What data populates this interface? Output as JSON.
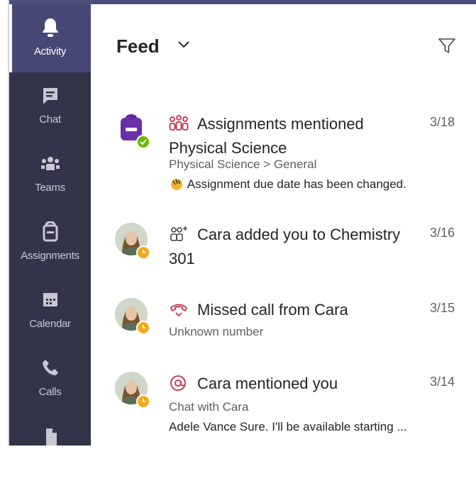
{
  "rail": {
    "items": [
      {
        "label": "Activity",
        "icon": "bell-icon",
        "active": true
      },
      {
        "label": "Chat",
        "icon": "chat-icon",
        "active": false
      },
      {
        "label": "Teams",
        "icon": "teams-icon",
        "active": false
      },
      {
        "label": "Assignments",
        "icon": "assignments-icon",
        "active": false
      },
      {
        "label": "Calendar",
        "icon": "calendar-icon",
        "active": false
      },
      {
        "label": "Calls",
        "icon": "phone-icon",
        "active": false
      },
      {
        "label": "",
        "icon": "files-icon",
        "active": false
      }
    ]
  },
  "header": {
    "title": "Feed"
  },
  "feed": [
    {
      "type_icon": "assignments-mention-icon",
      "title": "Assignments mentioned Physical Science",
      "date": "3/18",
      "line1": "Physical Science > General",
      "line2": "Assignment due date has been changed.",
      "avatar": "assignment-app-avatar",
      "status": "check"
    },
    {
      "type_icon": "added-to-team-icon",
      "title": "Cara added you to Chemistry 301",
      "date": "3/16",
      "avatar": "cara-avatar",
      "status": "away"
    },
    {
      "type_icon": "missed-call-icon",
      "title": "Missed call from Cara",
      "date": "3/15",
      "line1": "Unknown number",
      "avatar": "cara-avatar",
      "status": "away"
    },
    {
      "type_icon": "at-mention-icon",
      "title": "Cara mentioned you",
      "date": "3/14",
      "line1": "Chat with Cara",
      "line2": "Adele Vance Sure. I'll be available starting ...",
      "avatar": "cara-avatar",
      "status": "away"
    }
  ],
  "colors": {
    "rail_bg": "#33344a",
    "rail_active": "#464775",
    "accent_red": "#c4314b",
    "away": "#f8a71b",
    "available": "#6bb700",
    "assignments_purple": "#6b2fa8"
  }
}
